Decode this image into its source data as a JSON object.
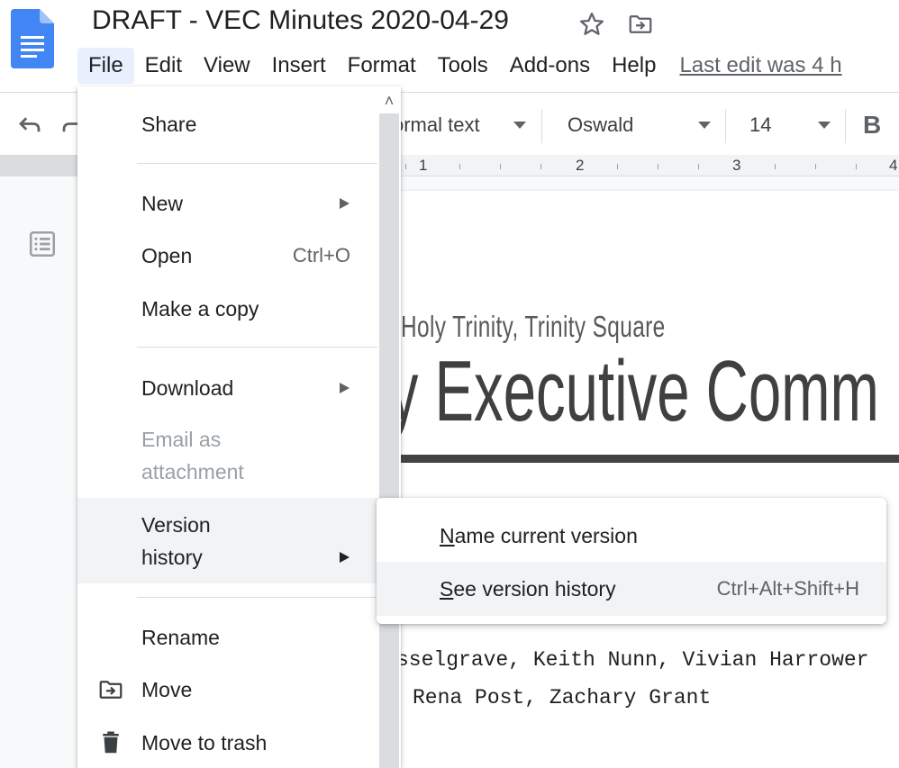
{
  "header": {
    "doc_title": "DRAFT - VEC Minutes 2020-04-29",
    "icons": [
      "docs-logo-icon",
      "star-icon",
      "move-to-folder-icon"
    ],
    "menubar": [
      "File",
      "Edit",
      "View",
      "Insert",
      "Format",
      "Tools",
      "Add-ons",
      "Help"
    ],
    "active_menu": "File",
    "last_edit": "Last edit was 4 h"
  },
  "toolbar": {
    "style": "ormal text",
    "font": "Oswald",
    "font_size": "14",
    "bold": "B",
    "icons": [
      "undo-icon",
      "redo-icon",
      "bold-icon"
    ]
  },
  "ruler": {
    "numbers": [
      "1",
      "2",
      "3",
      "4"
    ]
  },
  "document": {
    "subtitle": "he Holy Trinity, Trinity Square",
    "heading": "ry Executive Comm",
    "attendees_line1": "sselgrave, Keith Nunn, Vivian Harrower",
    "attendees_line2": "Rena Post, Zachary Grant"
  },
  "file_menu": {
    "share": "Share",
    "new": "New",
    "open": "Open",
    "open_shortcut": "Ctrl+O",
    "make_copy": "Make a copy",
    "download": "Download",
    "email_line1": "Email as",
    "email_line2": "attachment",
    "version_line1": "Version",
    "version_line2": "history",
    "rename": "Rename",
    "move": "Move",
    "trash": "Move to trash",
    "icons": [
      "move-folder-icon",
      "trash-icon",
      "submenu-arrow-icon",
      "scroll-up-icon"
    ]
  },
  "version_submenu": {
    "name_current_u": "N",
    "name_current_rest": "ame current version",
    "see_history_u": "S",
    "see_history_rest": "ee version history",
    "see_history_shortcut": "Ctrl+Alt+Shift+H"
  },
  "colors": {
    "accent": "#1a73e8",
    "active_menu_bg": "#e8f0fe",
    "hover_bg": "#f1f3f4",
    "heading_text": "#404040",
    "rule": "#434343"
  }
}
